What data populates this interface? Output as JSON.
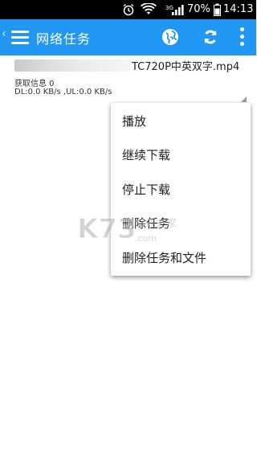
{
  "status_bar": {
    "network_label": "3G",
    "battery_percent": "70%",
    "time": "14:13"
  },
  "app_bar": {
    "title": "网络任务",
    "icons": [
      "menu-icon",
      "globe-icon",
      "refresh-icon",
      "more-vert-icon"
    ]
  },
  "task": {
    "file_name": "TC720P中英双字.mp4",
    "info": "获取信息 0",
    "speed": "DL:0.0 KB/s ,UL:0.0 KB/s"
  },
  "context_menu": {
    "items": [
      {
        "label": "播放"
      },
      {
        "label": "继续下载"
      },
      {
        "label": "停止下载"
      },
      {
        "label": "删除任务"
      },
      {
        "label": "删除任务和文件"
      }
    ]
  },
  "colors": {
    "app_bar": "#2196f3",
    "status_bar": "#000000"
  },
  "watermark": {
    "logo_text": "K73",
    "sub_text": "游戏之家",
    "domain": ".com"
  }
}
